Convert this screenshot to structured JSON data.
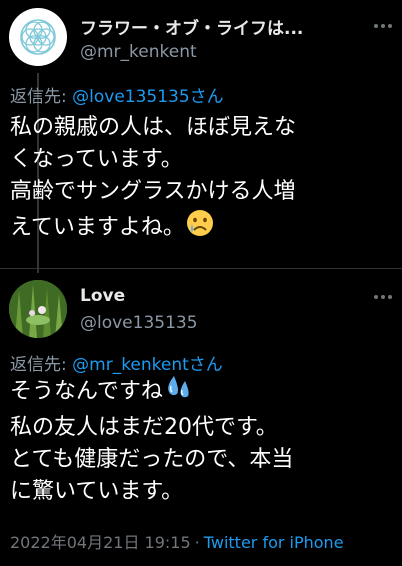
{
  "tweet1": {
    "display_name": "フラワー・オブ・ライフは...",
    "handle": "@mr_kenkent",
    "reply_prefix": "返信先: ",
    "reply_to": "@love135135さん",
    "lines": [
      "私の親戚の人は、ほぼ見えな",
      "くなっています。",
      "高齢でサングラスかける人増",
      "えていますよね。"
    ],
    "emoji": "crying-face"
  },
  "tweet2": {
    "display_name": "Love",
    "handle": "@love135135",
    "reply_prefix": "返信先: ",
    "reply_to": "@mr_kenkentさん",
    "lines": [
      "そうなんですね",
      "私の友人はまだ20代です。",
      "とても健康だったので、本当",
      "に驚いています。"
    ],
    "emoji": "sweat-droplets"
  },
  "footer": {
    "timestamp": "2022年04月21日 19:15",
    "separator": "·",
    "source": "Twitter for iPhone"
  },
  "colors": {
    "background": "#000000",
    "text": "#ffffff",
    "secondary": "#8b98a5",
    "link": "#1d9bf0"
  }
}
